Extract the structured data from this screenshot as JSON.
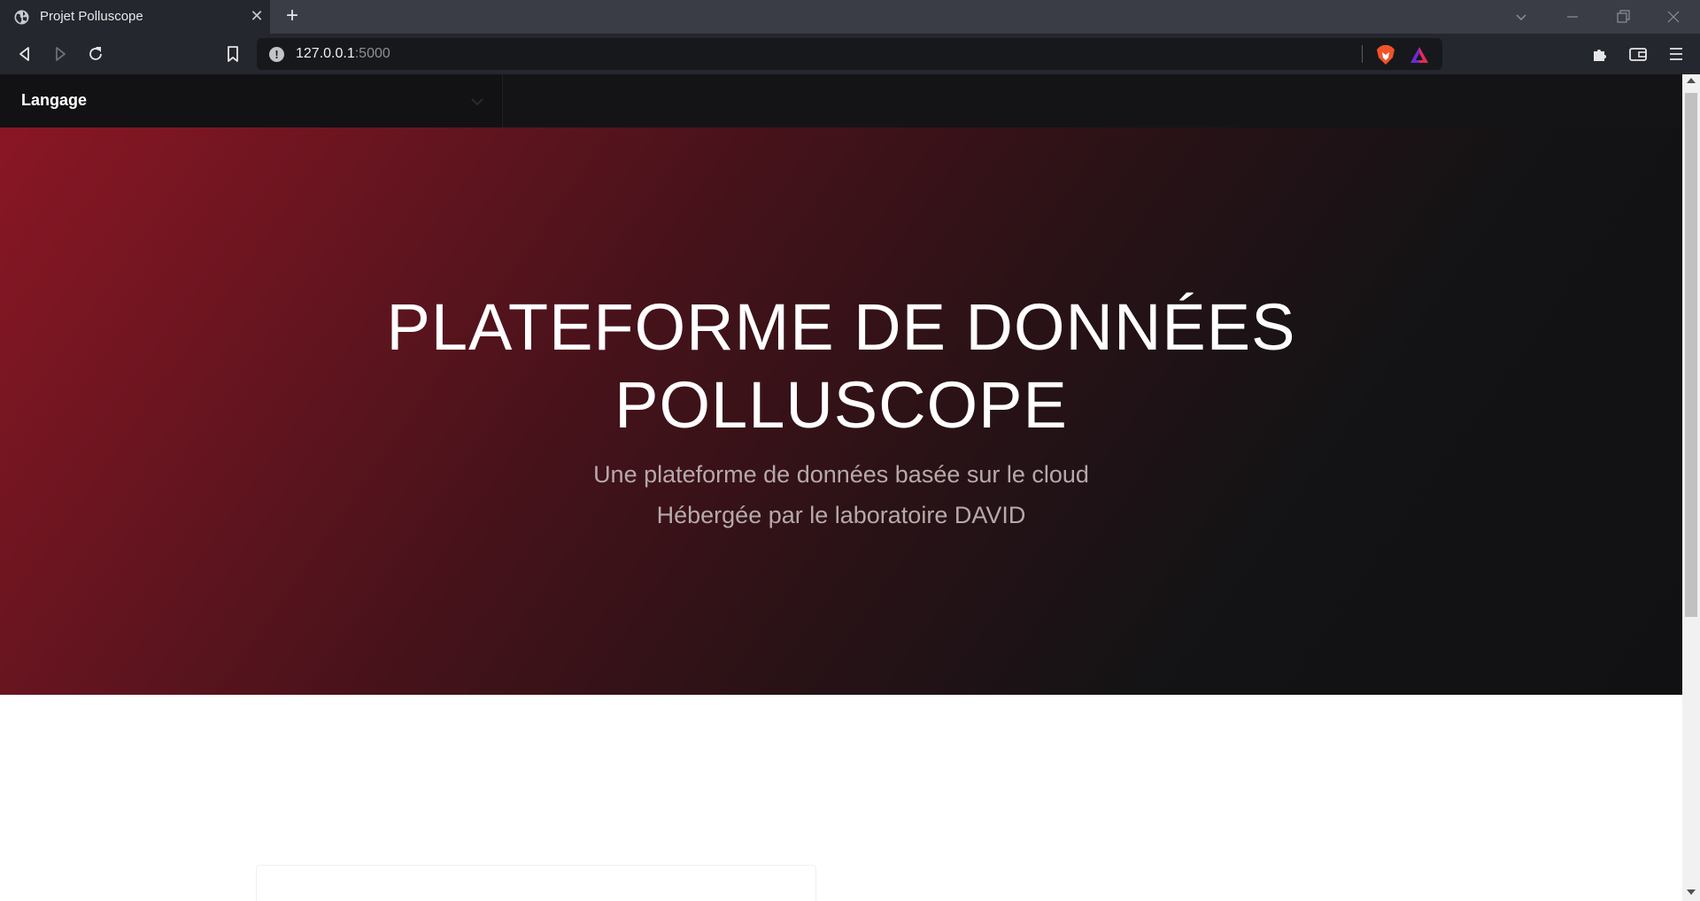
{
  "browser": {
    "tab": {
      "title": "Projet Polluscope",
      "favicon": "globe-icon"
    },
    "url": {
      "host": "127.0.0.1",
      "port": ":5000"
    },
    "icons": {
      "back": "back-arrow-icon",
      "forward": "forward-arrow-icon",
      "reload": "reload-icon",
      "bookmark": "bookmark-icon",
      "site_info": "info-icon",
      "shields": "brave-shield-icon",
      "rewards": "brave-rewards-icon",
      "extensions": "puzzle-icon",
      "wallet": "wallet-icon",
      "menu": "hamburger-menu-icon"
    }
  },
  "navbar": {
    "language_label": "Langage"
  },
  "hero": {
    "title_line1": "PLATEFORME DE DONNÉES",
    "title_line2": "POLLUSCOPE",
    "subtitle_line1": "Une plateforme de données basée sur le cloud",
    "subtitle_line2": "Hébergée par le laboratoire DAVID"
  },
  "colors": {
    "hero_gradient_start": "#8a1624",
    "hero_gradient_end": "#111113",
    "navbar_bg": "#141416",
    "chrome_bg": "#25272e"
  }
}
